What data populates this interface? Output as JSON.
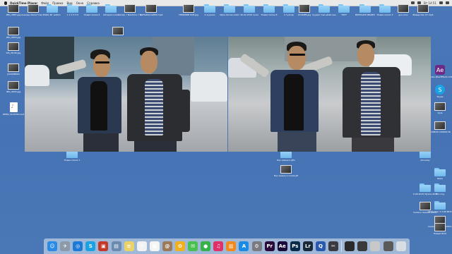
{
  "menubar": {
    "app_name": "QuickTime Player",
    "items": [
      "Файл",
      "Правка",
      "Вид",
      "Окно",
      "Справка"
    ],
    "clock": "Вт 14:51"
  },
  "desktop_icons": [
    {
      "label": "IMG_3887.jpg",
      "kind": "thumb"
    },
    {
      "label": "Акылды Жигиттер 2 ...mp4",
      "kind": "thumb"
    },
    {
      "label": "Hello Mr wilkins",
      "kind": "folder"
    },
    {
      "label": "1 2 3 4 5 6",
      "kind": "folder"
    },
    {
      "label": "Новая папка 6",
      "kind": "folder"
    },
    {
      "label": "Айгерим клип",
      "kind": "folder"
    },
    {
      "label": "Ампир ♪ Nokhcho ♪ Kuz...mp3",
      "kind": "thumb"
    },
    {
      "label": "2dd3e6Scnx6El4.mp4",
      "kind": "thumb"
    },
    {
      "label": "FREDWEB Кlift.jpg",
      "kind": "thumb"
    },
    {
      "label": "2 журнал",
      "kind": "folder"
    },
    {
      "label": "Ирон бичэм майл",
      "kind": "folder"
    },
    {
      "label": "20.02.2015 Асия",
      "kind": "folder"
    },
    {
      "label": "Новая папка 8",
      "kind": "folder"
    },
    {
      "label": "4 тулпар",
      "kind": "folder"
    },
    {
      "label": "АТАКИМ.jpg",
      "kind": "thumb"
    },
    {
      "label": "Суудет пай ыбай кыздыкы",
      "kind": "folder"
    },
    {
      "label": "ТОРТ",
      "kind": "folder"
    },
    {
      "label": "ВОРКШОП ВИДЕО",
      "kind": "folder"
    },
    {
      "label": "Новая папка 3",
      "kind": "folder"
    },
    {
      "label": "gou.mov",
      "kind": "thumb"
    },
    {
      "label": "Виварство 07.mp4",
      "kind": "thumb"
    },
    {
      "label": "IMG_9833.jpg",
      "kind": "thumb"
    },
    {
      "label": "Скриншот 2015.jpg",
      "kind": "thumb"
    },
    {
      "label": "WS_28-06.jpg",
      "kind": "thumb"
    },
    {
      "label": "JACKOBSSN",
      "kind": "thumb"
    },
    {
      "label": "IMG_9843.jpg",
      "kind": "thumb"
    },
    {
      "label": "DEMO_SLX03IS.mp3",
      "kind": "doc"
    },
    {
      "label": "Новая папка 7",
      "kind": "folder"
    },
    {
      "label": "Без имени-1.JPG",
      "kind": "folder"
    },
    {
      "label": "Без имени-1 копия.JPG",
      "kind": "thumb"
    },
    {
      "label": "Adobe AfterEffects CS6",
      "kind": "app"
    },
    {
      "label": "Skype",
      "kind": "app"
    },
    {
      "label": "Oyla",
      "kind": "thumb"
    },
    {
      "label": "ЗАПИСИ СКОРОСТЬ",
      "kind": "thumb"
    },
    {
      "label": "Amnesty",
      "kind": "folder"
    },
    {
      "label": "Nebij",
      "kind": "folder"
    },
    {
      "label": "Mrs ring",
      "kind": "folder"
    },
    {
      "label": "Мой клип 2 2.9K.MOV",
      "kind": "folder"
    },
    {
      "label": "6.06.2015 Мухим ФОТОСЕССИЯ",
      "kind": "folder"
    },
    {
      "label": "Снимок экрана 2015-0...1.26.31",
      "kind": "thumb"
    },
    {
      "label": "Снимок экрана 2015-0...1.06.19",
      "kind": "thumb"
    },
    {
      "label": "Новый DIVX",
      "kind": "thumb"
    }
  ],
  "players": {
    "left": {
      "title": "Новая папка 7"
    },
    "right": {
      "title": ""
    }
  },
  "dock": {
    "apps": [
      {
        "name": "finder-icon",
        "glyph": "☺",
        "color": "#2a8ae6"
      },
      {
        "name": "launchpad-icon",
        "glyph": "✈",
        "color": "#8a9aa8"
      },
      {
        "name": "safari-icon",
        "glyph": "◎",
        "color": "#1a7ad6"
      },
      {
        "name": "skype-icon",
        "glyph": "S",
        "color": "#1aa1e6"
      },
      {
        "name": "photo-booth-icon",
        "glyph": "▣",
        "color": "#c43a2a"
      },
      {
        "name": "preview-icon",
        "glyph": "▤",
        "color": "#6a8ab0"
      },
      {
        "name": "notes-icon",
        "glyph": "≡",
        "color": "#e8d26a"
      },
      {
        "name": "reminders-icon",
        "glyph": "☰",
        "color": "#f2f2f2"
      },
      {
        "name": "calendar-icon",
        "glyph": "▦",
        "color": "#f4f4f4"
      },
      {
        "name": "contacts-icon",
        "glyph": "@",
        "color": "#9a7a5a"
      },
      {
        "name": "photos-icon",
        "glyph": "✿",
        "color": "#f0b020"
      },
      {
        "name": "messages-icon",
        "glyph": "✉",
        "color": "#4ac050"
      },
      {
        "name": "facetime-icon",
        "glyph": "●",
        "color": "#3ab04a"
      },
      {
        "name": "itunes-icon",
        "glyph": "♫",
        "color": "#e0306a"
      },
      {
        "name": "ibooks-icon",
        "glyph": "▥",
        "color": "#f08a20"
      },
      {
        "name": "app-store-icon",
        "glyph": "A",
        "color": "#1a8ae6"
      },
      {
        "name": "system-preferences-icon",
        "glyph": "⚙",
        "color": "#7a7a80"
      },
      {
        "name": "premiere-icon",
        "glyph": "Pr",
        "color": "#2a0a3a"
      },
      {
        "name": "after-effects-icon",
        "glyph": "Ae",
        "color": "#1a0a3a"
      },
      {
        "name": "photoshop-icon",
        "glyph": "Ps",
        "color": "#0a2a4a"
      },
      {
        "name": "lightroom-icon",
        "glyph": "Lr",
        "color": "#1a2a3a"
      },
      {
        "name": "quicktime-icon",
        "glyph": "Q",
        "color": "#2a5ab0"
      },
      {
        "name": "final-cut-icon",
        "glyph": "✂",
        "color": "#3a3a40"
      }
    ],
    "others": [
      {
        "name": "downloads-stack-icon",
        "color": "#2a2a2a"
      },
      {
        "name": "documents-stack-icon",
        "color": "#3a3a3a"
      },
      {
        "name": "screenshot-stack-icon",
        "color": "#c8c8c8"
      },
      {
        "name": "video-stack-icon",
        "color": "#5a5a5a"
      },
      {
        "name": "trash-icon",
        "color": "#d8dde2"
      }
    ]
  }
}
